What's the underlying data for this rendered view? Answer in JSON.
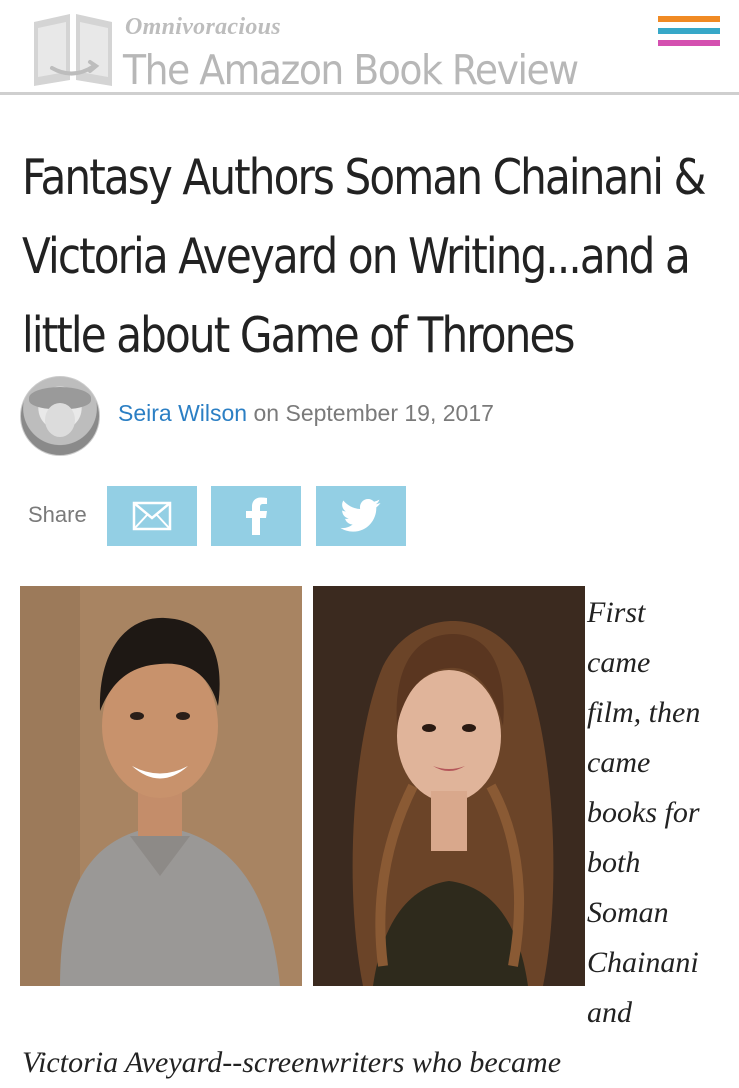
{
  "header": {
    "logo_subtitle": "Omnivoracious",
    "logo_title": "The Amazon Book Review",
    "logo_icon": "book-icon",
    "menu_icon": "hamburger-menu-icon",
    "menu_colors": [
      "#f08a24",
      "#37a8c8",
      "#d450b0"
    ]
  },
  "article": {
    "title": "Fantasy Authors Soman Chainani & Victoria Aveyard on Writing...and a little about Game of Thrones",
    "author": "Seira Wilson",
    "on_label": "on",
    "date": "September 19, 2017"
  },
  "share": {
    "label": "Share",
    "buttons": [
      {
        "icon": "email-icon"
      },
      {
        "icon": "facebook-icon"
      },
      {
        "icon": "twitter-icon"
      }
    ],
    "button_color": "#93cfe4"
  },
  "body": {
    "wrapped_lines": [
      "First",
      "came",
      "film, then",
      "came",
      "books for",
      "both",
      "Soman",
      "Chainani",
      "and"
    ],
    "continued_line": "Victoria Aveyard--screenwriters who became"
  }
}
